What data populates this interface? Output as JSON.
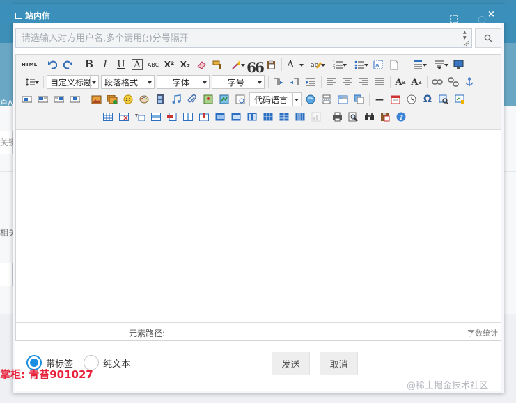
{
  "dialog": {
    "title": "站内信",
    "close_symbol": "×",
    "faint_title_glyph": "○"
  },
  "recipient": {
    "placeholder": "请选输入对方用户名,多个请用(;)分号隔开",
    "value": ""
  },
  "toolbar": {
    "html_label": "HTML",
    "bold": "B",
    "italic": "I",
    "underline": "U",
    "font_border": "A",
    "strike": "ABC",
    "superscript": "X²",
    "subscript": "X₂",
    "quote": "66",
    "font_color": "A",
    "heading_combo": "自定义标题",
    "paragraph_combo": "段落格式",
    "fontfamily_combo": "字体",
    "fontsize_combo": "字号",
    "code_combo": "代码语言",
    "hr": "—",
    "omega": "Ω",
    "help": "?"
  },
  "editor": {
    "element_path_label": "元素路径:",
    "word_count_label": "字数统计"
  },
  "options": {
    "rich": "带标签",
    "plain": "纯文本",
    "selected": "rich"
  },
  "actions": {
    "send": "发送",
    "cancel": "取消"
  },
  "overlay": {
    "shopkeeper": "掌柜: 青苔901027",
    "watermark": "@稀土掘金技术社区"
  },
  "background": {
    "side_text_1": "户A",
    "side_text_2": "关键",
    "side_text_3": "相关"
  },
  "colors": {
    "title_bar": "#3a8fbb",
    "accent": "#1a8ee0",
    "shop_text": "#e8203a"
  }
}
